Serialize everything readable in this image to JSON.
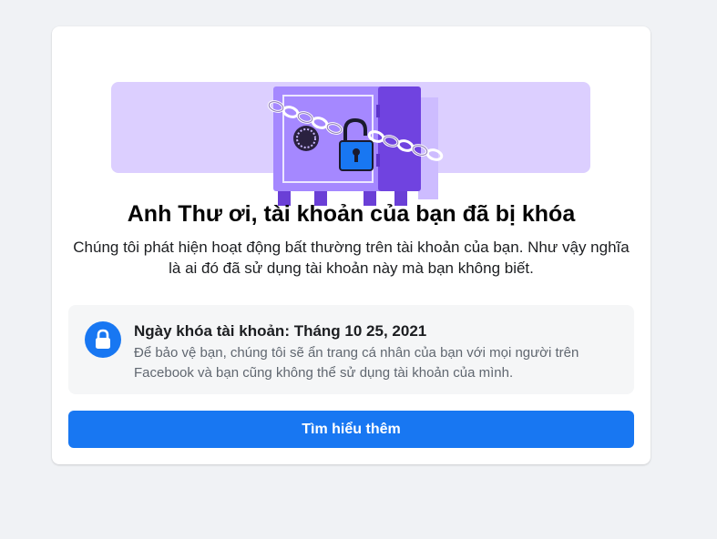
{
  "locked_notice": {
    "title": "Anh Thư ơi, tài khoản của bạn đã bị khóa",
    "description": "Chúng tôi phát hiện hoạt động bất thường trên tài khoản của bạn. Như vậy nghĩa là ai đó đã sử dụng tài khoản này mà bạn không biết.",
    "lock_date_title": "Ngày khóa tài khoản: Tháng 10 25, 2021",
    "lock_date_text": "Để bảo vệ bạn, chúng tôi sẽ ẩn trang cá nhân của bạn với mọi người trên Facebook và bạn cũng không thể sử dụng tài khoản của mình.",
    "button_label": "Tìm hiểu thêm"
  },
  "icons": {
    "hero": "locked-safe-illustration",
    "info": "lock-icon"
  },
  "colors": {
    "accent": "#1877f2",
    "background": "#f0f2f5",
    "illustration_light": "#d9ccff",
    "illustration_main": "#a07bff",
    "illustration_dark": "#6a3fd6"
  }
}
